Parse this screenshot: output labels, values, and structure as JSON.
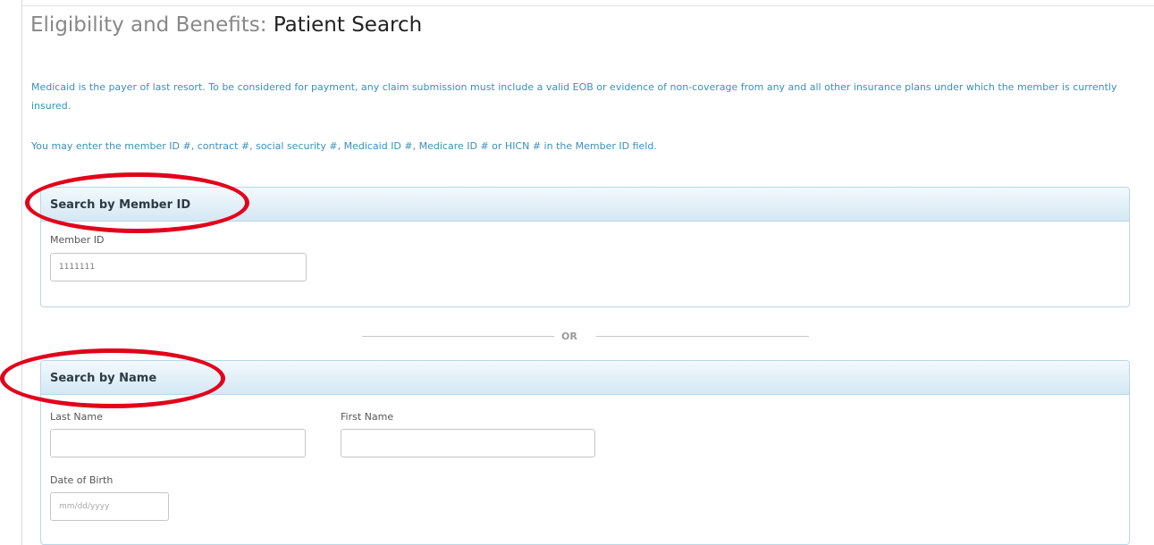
{
  "page": {
    "title_prefix": "Eligibility and Benefits:",
    "title_main": "Patient Search"
  },
  "intro": {
    "paragraph_1": "Medicaid is the payer of last resort. To be considered for payment, any claim submission must include a valid EOB or evidence of non-coverage from any and all other insurance plans under which the member is currently insured.",
    "paragraph_2": "You may enter the member ID #, contract #, social security #, Medicaid ID #, Medicare ID # or HICN # in the Member ID field."
  },
  "member_search": {
    "title": "Search by Member ID",
    "member_id_label": "Member ID",
    "member_id_value": "1111111"
  },
  "separator": {
    "label": "OR"
  },
  "name_search": {
    "title": "Search by Name",
    "last_name_label": "Last Name",
    "last_name_value": "",
    "first_name_label": "First Name",
    "first_name_value": "",
    "dob_label": "Date of Birth",
    "dob_placeholder": "mm/dd/yyyy",
    "dob_value": ""
  },
  "colors": {
    "info_text": "#3d8fba",
    "panel_border": "#b9d7e8",
    "highlight": "#e3001b"
  }
}
